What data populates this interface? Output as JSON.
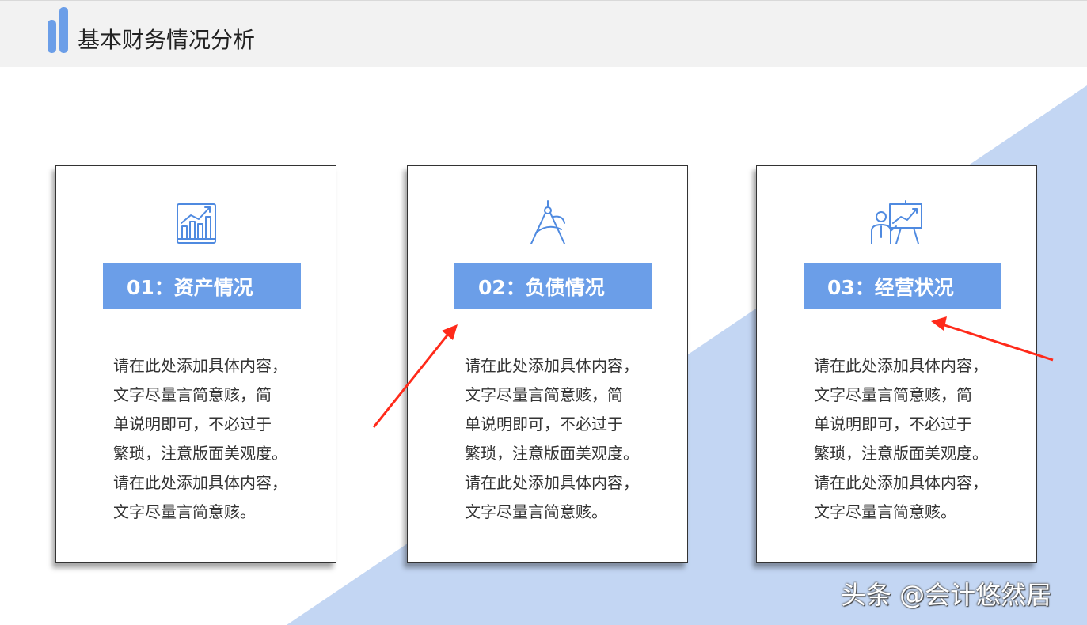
{
  "header": {
    "title": "基本财务情况分析"
  },
  "cards": [
    {
      "icon": "bar-chart-growth-icon",
      "tag": "01：资产情况",
      "body": [
        "请在此处添加具体内容，",
        "文字尽量言简意赅，简",
        "单说明即可，不必过于",
        "繁琐，注意版面美观度。",
        "请在此处添加具体内容，",
        "文字尽量言简意赅。"
      ]
    },
    {
      "icon": "compass-drawing-icon",
      "tag": "02：负债情况",
      "body": [
        "请在此处添加具体内容，",
        "文字尽量言简意赅，简",
        "单说明即可，不必过于",
        "繁琐，注意版面美观度。",
        "请在此处添加具体内容，",
        "文字尽量言简意赅。"
      ]
    },
    {
      "icon": "presenter-board-icon",
      "tag": "03：经营状况",
      "body": [
        "请在此处添加具体内容，",
        "文字尽量言简意赅，简",
        "单说明即可，不必过于",
        "繁琐，注意版面美观度。",
        "请在此处添加具体内容，",
        "文字尽量言简意赅。"
      ]
    }
  ],
  "watermark": "头条 @会计悠然居",
  "colors": {
    "accent": "#6b9ee8",
    "background_triangle": "#c3d6f3",
    "annotation_arrow": "#ff2a1a"
  }
}
